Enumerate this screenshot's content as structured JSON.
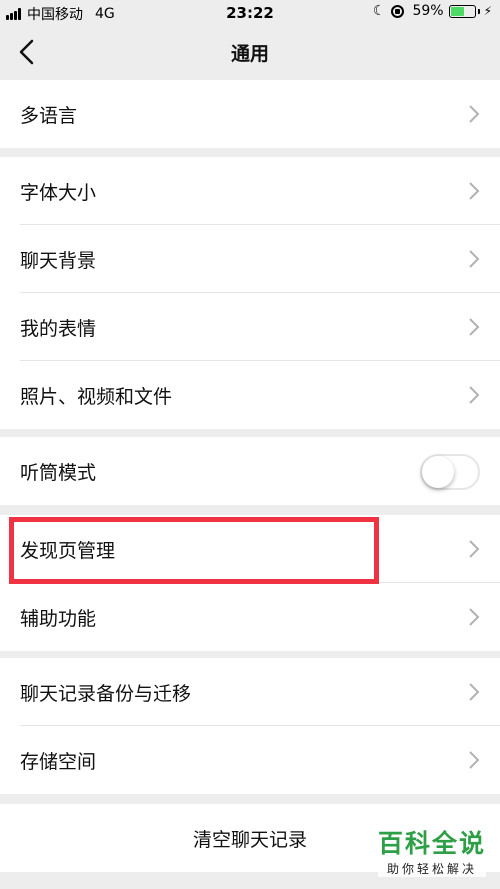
{
  "status_bar": {
    "carrier": "中国移动",
    "network": "4G",
    "time": "23:22",
    "battery_percent": "59%",
    "battery_level": 0.59,
    "battery_color": "#4cd964"
  },
  "header": {
    "title": "通用",
    "back_icon": "chevron-left-icon"
  },
  "groups": {
    "language": {
      "label": "多语言"
    },
    "display": {
      "font_size": "字体大小",
      "chat_background": "聊天背景",
      "my_stickers": "我的表情",
      "media_files": "照片、视频和文件"
    },
    "earpiece": {
      "label": "听筒模式",
      "enabled": false
    },
    "features": {
      "discover_management": "发现页管理",
      "accessibility": "辅助功能"
    },
    "storage": {
      "chat_backup": "聊天记录备份与迁移",
      "storage_space": "存储空间"
    },
    "clear": {
      "label": "清空聊天记录"
    }
  },
  "annotation": {
    "highlight_color": "#ef3342"
  },
  "watermark": {
    "title": "百科全说",
    "subtitle": "助你轻松解决"
  }
}
